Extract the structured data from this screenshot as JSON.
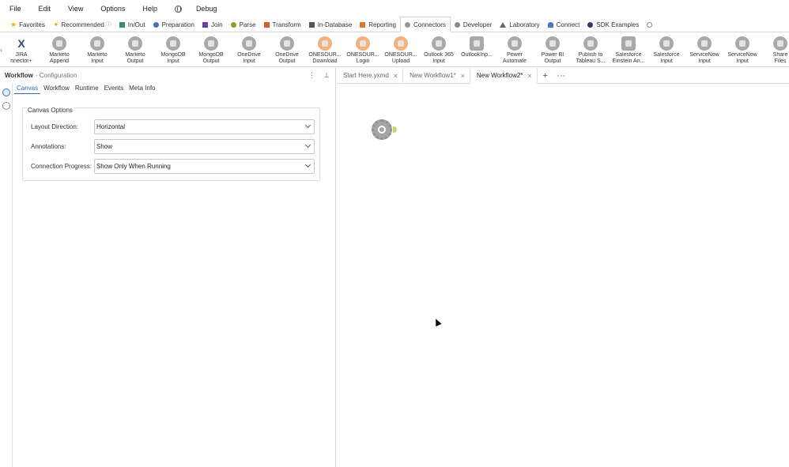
{
  "menu": {
    "items": [
      {
        "label": "File",
        "accel": "F"
      },
      {
        "label": "Edit",
        "accel": "E"
      },
      {
        "label": "View",
        "accel": "V"
      },
      {
        "label": "Options",
        "accel": "O"
      },
      {
        "label": "Help",
        "accel": "H"
      }
    ],
    "debug_label": "Debug"
  },
  "categories": [
    {
      "label": "Favorites",
      "icon": "star-icon",
      "color": "#e8b400"
    },
    {
      "label": "Recommended",
      "icon": "star-icon",
      "color": "#e8b400"
    },
    {
      "label": "In/Out",
      "icon": "folder-icon",
      "color": "#3a8c7a"
    },
    {
      "label": "Preparation",
      "icon": "circle-icon",
      "color": "#3a73b8"
    },
    {
      "label": "Join",
      "icon": "square-icon",
      "color": "#6a3fa0"
    },
    {
      "label": "Parse",
      "icon": "circle-icon",
      "color": "#7fa52a"
    },
    {
      "label": "Transform",
      "icon": "square-icon",
      "color": "#d95b2b"
    },
    {
      "label": "In-Database",
      "icon": "list-icon",
      "color": "#555555"
    },
    {
      "label": "Reporting",
      "icon": "bookmark-icon",
      "color": "#e07a2a"
    },
    {
      "label": "Connectors",
      "icon": "circle-icon",
      "color": "#9a9a9a",
      "active": true
    },
    {
      "label": "Developer",
      "icon": "circle-icon",
      "color": "#8a8a8a"
    },
    {
      "label": "Laboratory",
      "icon": "triangle-icon",
      "color": "#666666"
    },
    {
      "label": "Connect",
      "icon": "cloud-icon",
      "color": "#4a78c0"
    },
    {
      "label": "SDK Examples",
      "icon": "circle-icon",
      "color": "#2a3a6a"
    }
  ],
  "tools": [
    {
      "label": "JIRA\nnnector+",
      "icon": "jira-icon"
    },
    {
      "label": "Marketo\nAppend",
      "icon": "marketo-append-icon"
    },
    {
      "label": "Marketo\nInput",
      "icon": "marketo-input-icon"
    },
    {
      "label": "Marketo\nOutput",
      "icon": "marketo-output-icon"
    },
    {
      "label": "MongoDB\nInput",
      "icon": "mongodb-input-icon"
    },
    {
      "label": "MongoDB\nOutput",
      "icon": "mongodb-output-icon"
    },
    {
      "label": "OneDrive\nInput",
      "icon": "onedrive-input-icon"
    },
    {
      "label": "OneDrive\nOutput",
      "icon": "onedrive-output-icon"
    },
    {
      "label": "ONESOUR...\nDownload",
      "icon": "onesource-download-icon"
    },
    {
      "label": "ONESOUR...\nLogin",
      "icon": "onesource-login-icon"
    },
    {
      "label": "ONESOUR...\nUpload",
      "icon": "onesource-upload-icon"
    },
    {
      "label": "Outlook 365\nInput",
      "icon": "outlook-365-input-icon"
    },
    {
      "label": "OutlookInp...",
      "icon": "outlook-input-icon"
    },
    {
      "label": "Power\nAutomate",
      "icon": "power-automate-icon"
    },
    {
      "label": "Power BI\nOutput",
      "icon": "power-bi-output-icon"
    },
    {
      "label": "Publish to\nTableau S...",
      "icon": "publish-tableau-icon"
    },
    {
      "label": "Salesforce\nEinstein An...",
      "icon": "salesforce-einstein-icon"
    },
    {
      "label": "Salesforce\nInput",
      "icon": "salesforce-input-icon"
    },
    {
      "label": "ServiceNow\nInput",
      "icon": "servicenow-input-icon"
    },
    {
      "label": "ServiceNow\nInput",
      "icon": "servicenow-input-2-icon"
    },
    {
      "label": "Share\nFiles",
      "icon": "sharefile-icon"
    }
  ],
  "config": {
    "title": "Workflow",
    "subtitle": "- Configuration",
    "tabs": [
      "Canvas",
      "Workflow",
      "Runtime",
      "Events",
      "Meta Info"
    ],
    "section_title": "Canvas Options",
    "fields": [
      {
        "label": "Layout Direction:",
        "value": "Horizontal"
      },
      {
        "label": "Annotations:",
        "value": "Show"
      },
      {
        "label": "Connection Progress:",
        "value": "Show Only When Running"
      }
    ]
  },
  "doc_tabs": [
    {
      "label": "Start Here.yxmd"
    },
    {
      "label": "New Workflow1*"
    },
    {
      "label": "New Workflow2*",
      "active": true
    }
  ],
  "doc_actions": {
    "add": "+",
    "more": "···"
  },
  "colors": {
    "accent": "#2e6cb5",
    "border": "#d8d8d8"
  }
}
